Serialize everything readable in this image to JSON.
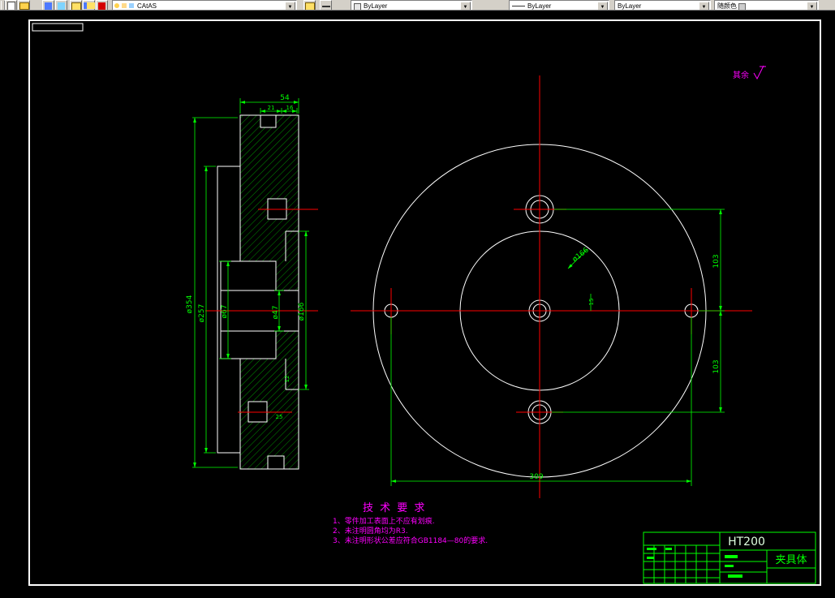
{
  "toolbar": {
    "layer_dropdown_value": "CAtAS",
    "color_dropdown_value": "ByLayer",
    "linetype_dropdown_value": "ByLayer",
    "lineweight_dropdown_value": "ByLayer",
    "plotstyle_dropdown_value": "随颜色",
    "dropdown_arrow": "▼"
  },
  "drawing": {
    "surface_note": "其余",
    "tech_requirements": {
      "title": "技 术 要 求",
      "item1": "1、零件加工表面上不应有划痕.",
      "item2": "2、未注明圆角均为R3.",
      "item3": "3、未注明形状公差应符合GB1184—80的要求."
    },
    "dims": {
      "w54": "54",
      "w21": "21",
      "w16": "16",
      "dia354": "ø354",
      "dia257": "ø257",
      "dia67": "ø67",
      "dia47": "ø47",
      "dia166_section": "ø166",
      "len309": "309",
      "len103_upper": "103",
      "len103_lower": "103",
      "len15": "15",
      "dia166_front": "ø166",
      "small12": "12",
      "small25": "25"
    },
    "title_block": {
      "material": "HT200",
      "part_name": "夹具体"
    },
    "colors": {
      "outline": "#ffffff",
      "dimension": "#00ff00",
      "centerline": "#ff0000",
      "annotation": "#ff00ff",
      "background": "#000000"
    }
  }
}
